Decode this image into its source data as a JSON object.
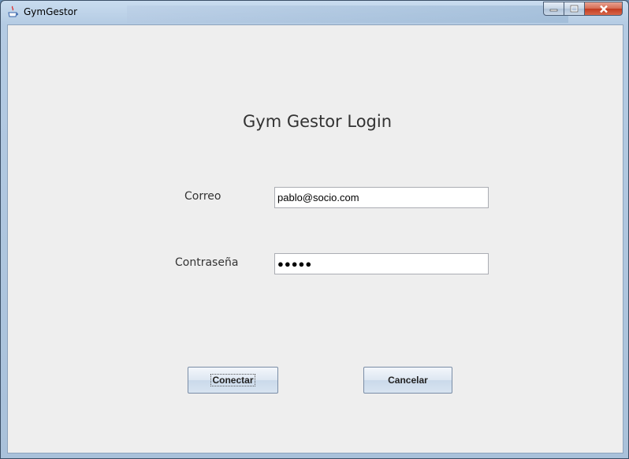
{
  "window": {
    "title": "GymGestor",
    "controls": {
      "minimize": "minimize",
      "maximize": "maximize",
      "close": "close"
    }
  },
  "login": {
    "heading": "Gym Gestor Login",
    "email_label": "Correo",
    "email_value": "pablo@socio.com",
    "password_label": "Contraseña",
    "password_mask": "●●●●●",
    "connect_label": "Conectar",
    "cancel_label": "Cancelar"
  },
  "colors": {
    "content_bg": "#eeeeee",
    "close_button": "#c23b1f"
  },
  "icons": [
    "java-app-icon",
    "minimize-icon",
    "maximize-icon",
    "close-icon"
  ]
}
